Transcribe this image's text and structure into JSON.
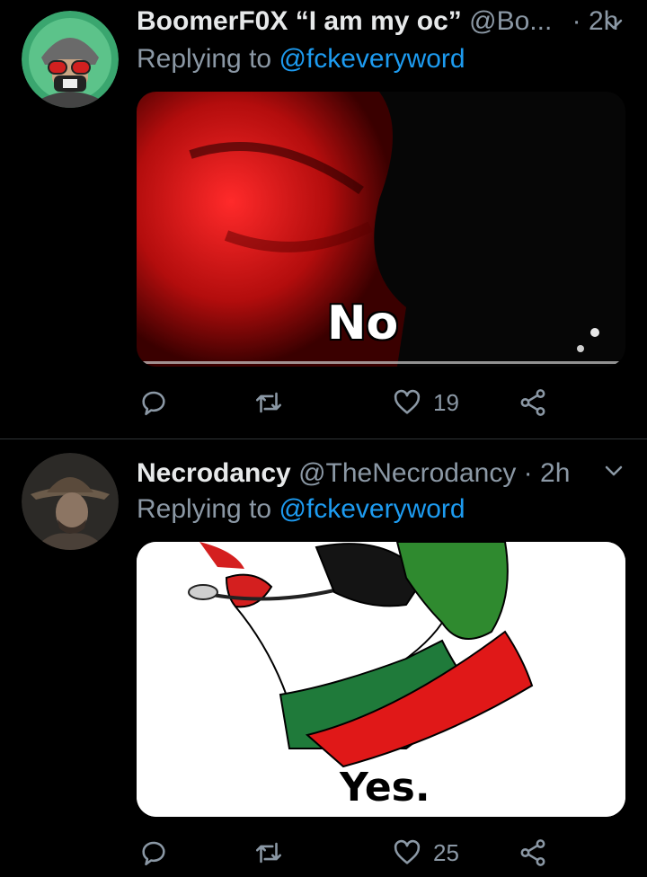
{
  "tweets": [
    {
      "author_name": "BoomerF0X “I am my oc”",
      "handle": "@Bo...",
      "time": "2h",
      "replying_prefix": "Replying to",
      "replying_to": "@fckeveryword",
      "media_text": "No",
      "like_count": "19"
    },
    {
      "author_name": "Necrodancy",
      "handle": "@TheNecrodancy",
      "time": "2h",
      "replying_prefix": "Replying to",
      "replying_to": "@fckeveryword",
      "media_text": "Yes.",
      "like_count": "25"
    }
  ],
  "separator": "·",
  "icons": [
    "reply-icon",
    "retweet-icon",
    "like-icon",
    "share-icon",
    "chevron-down-icon"
  ],
  "colors": {
    "background": "#000000",
    "mention": "#1d9bf0",
    "secondary_text": "#8b98a5"
  }
}
